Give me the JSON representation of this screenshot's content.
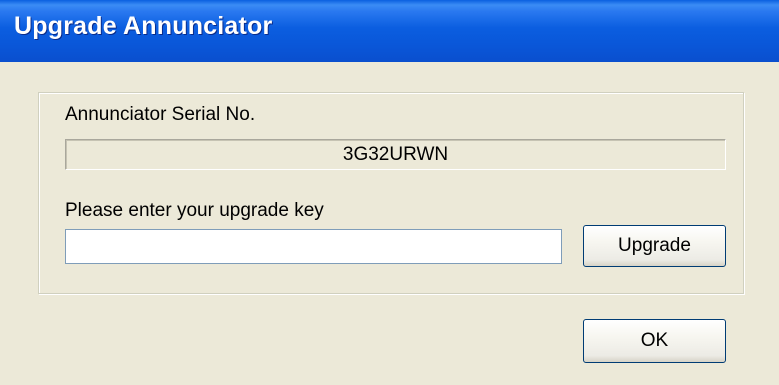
{
  "window": {
    "title": "Upgrade Annunciator"
  },
  "serial": {
    "label": "Annunciator Serial No.",
    "value": "3G32URWN"
  },
  "upgrade_key": {
    "label": "Please enter your upgrade key",
    "value": "",
    "placeholder": ""
  },
  "buttons": {
    "upgrade_label": "Upgrade",
    "ok_label": "OK"
  },
  "colors": {
    "titlebar": "#0a56d8",
    "dialog_background": "#ece9d8",
    "button_border": "#003c74",
    "input_border": "#7f9db9"
  }
}
